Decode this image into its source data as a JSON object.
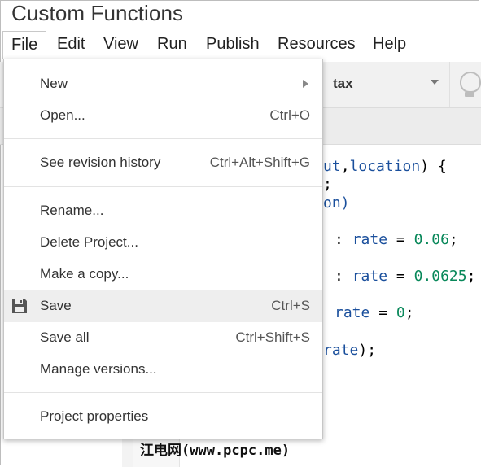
{
  "app": {
    "title": "Custom Functions"
  },
  "menubar": {
    "items": [
      "File",
      "Edit",
      "View",
      "Run",
      "Publish",
      "Resources",
      "Help"
    ]
  },
  "toolbar": {
    "function_select": "tax"
  },
  "code": {
    "line1": {
      "a": "ut",
      "b": ",",
      "c": "location",
      "d": ") {"
    },
    "line2": ";",
    "line3": "on)",
    "line4": {
      "a": ": ",
      "b": "rate",
      "c": " = ",
      "d": "0.06",
      "e": ";"
    },
    "line5": {
      "a": ": ",
      "b": "rate",
      "c": " = ",
      "d": "0.0625",
      "e": ";"
    },
    "line6": {
      "b": "rate",
      "c": " = ",
      "d": "0",
      "e": ";"
    },
    "line7": {
      "b": "rate",
      "e": ");"
    }
  },
  "file_menu": {
    "new": "New",
    "open": "Open...",
    "open_shortcut": "Ctrl+O",
    "revision": "See revision history",
    "revision_shortcut": "Ctrl+Alt+Shift+G",
    "rename": "Rename...",
    "delete": "Delete Project...",
    "copy": "Make a copy...",
    "save": "Save",
    "save_shortcut": "Ctrl+S",
    "save_all": "Save all",
    "save_all_shortcut": "Ctrl+Shift+S",
    "versions": "Manage versions...",
    "properties": "Project properties"
  },
  "icons": {
    "save": "floppy-disk-icon",
    "submenu": "submenu-arrow-icon",
    "hint": "lightbulb-icon"
  },
  "watermark": "江电网(www.pcpc.me)"
}
